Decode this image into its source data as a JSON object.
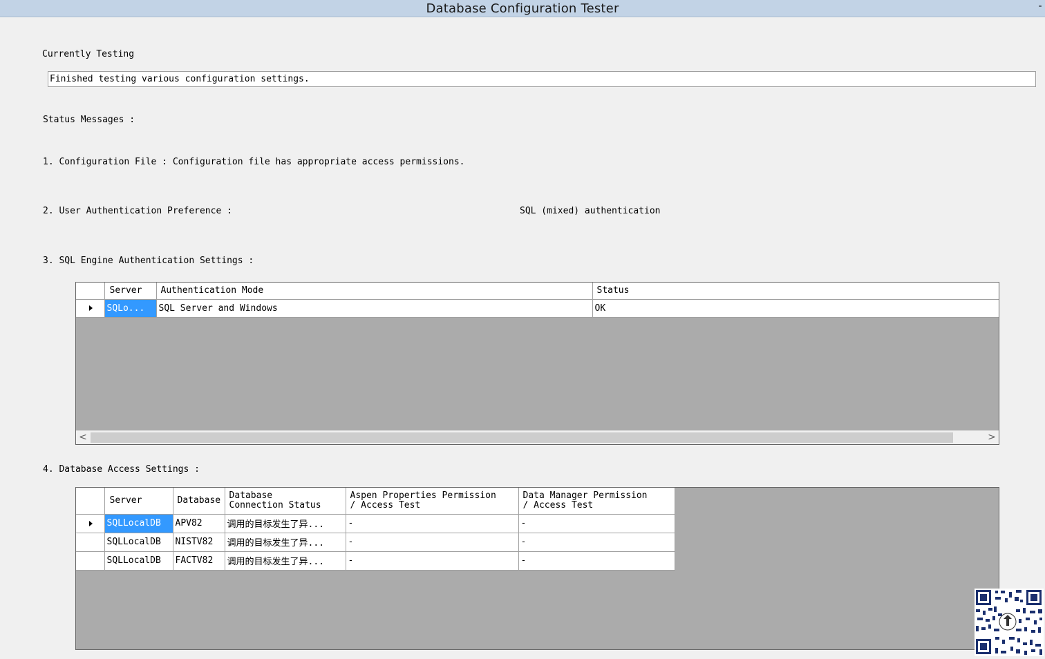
{
  "window": {
    "title": "Database Configuration Tester",
    "minimize_label": "-"
  },
  "currently_testing": {
    "label": "Currently Testing",
    "value": "Finished testing various configuration settings."
  },
  "status_messages_label": "Status Messages :",
  "messages": {
    "config_file": "1. Configuration File : Configuration file has appropriate access permissions.",
    "auth_pref_label": "2. User Authentication Preference :",
    "auth_pref_value": "SQL (mixed) authentication",
    "sql_engine_label": "3. SQL Engine Authentication Settings :",
    "db_access_label": "4. Database Access Settings :"
  },
  "engine_grid": {
    "columns": [
      "Server",
      "Authentication Mode",
      "Status"
    ],
    "rows": [
      {
        "server": "SQLo...",
        "auth_mode": "SQL Server and Windows",
        "status": "OK"
      }
    ],
    "scroll_left": "<",
    "scroll_right": ">"
  },
  "access_grid": {
    "columns": {
      "server": "Server",
      "database": "Database",
      "conn_status": "Database\nConnection Status",
      "aspen": "Aspen Properties Permission\n/ Access Test",
      "dm": "Data Manager Permission\n/ Access Test"
    },
    "rows": [
      {
        "server": "SQLLocalDB",
        "database": "APV82",
        "conn_status": "调用的目标发生了异...",
        "aspen": "-",
        "dm": "-"
      },
      {
        "server": "SQLLocalDB",
        "database": "NISTV82",
        "conn_status": "调用的目标发生了异...",
        "aspen": "-",
        "dm": "-"
      },
      {
        "server": "SQLLocalDB",
        "database": "FACTV82",
        "conn_status": "调用的目标发生了异...",
        "aspen": "-",
        "dm": "-"
      }
    ]
  }
}
